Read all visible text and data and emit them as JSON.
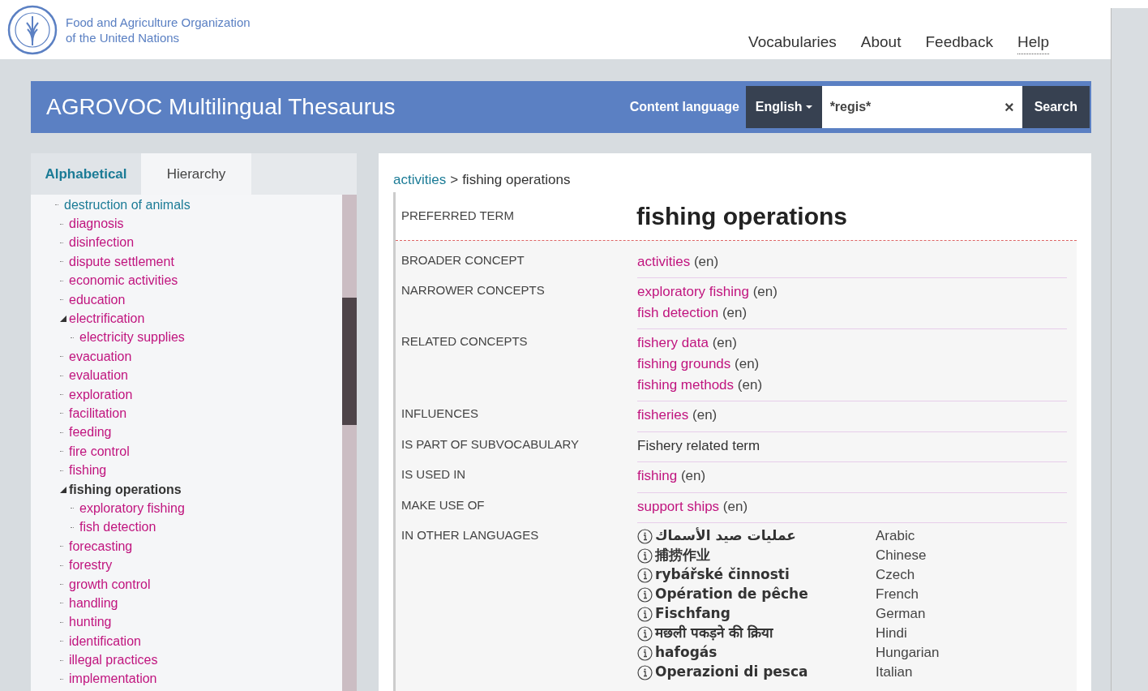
{
  "header": {
    "org_name": [
      "Food and Agriculture Organization",
      "of the United Nations"
    ],
    "nav": [
      {
        "label": "Vocabularies",
        "dotted": false
      },
      {
        "label": "About",
        "dotted": false
      },
      {
        "label": "Feedback",
        "dotted": false
      },
      {
        "label": "Help",
        "dotted": true
      }
    ]
  },
  "banner": {
    "title": "AGROVOC Multilingual Thesaurus",
    "content_language_label": "Content language",
    "language": "English",
    "search_value": "*regis*",
    "clear": "×",
    "search_button": "Search"
  },
  "sidebar": {
    "tabs": [
      {
        "label": "Alphabetical",
        "selected": true
      },
      {
        "label": "Hierarchy",
        "selected": false
      }
    ],
    "tree": [
      {
        "label": "destruction of animals",
        "visited": true,
        "selected": false
      },
      {
        "label": "diagnosis",
        "visited": false,
        "selected": false
      },
      {
        "label": "disinfection",
        "visited": false,
        "selected": false
      },
      {
        "label": "dispute settlement",
        "visited": false,
        "selected": false
      },
      {
        "label": "economic activities",
        "visited": false,
        "selected": false
      },
      {
        "label": "education",
        "visited": false,
        "selected": false
      },
      {
        "label": "electrification",
        "visited": false,
        "selected": false,
        "expanded": true,
        "children": [
          {
            "label": "electricity supplies",
            "visited": false,
            "selected": false
          }
        ]
      },
      {
        "label": "evacuation",
        "visited": false,
        "selected": false
      },
      {
        "label": "evaluation",
        "visited": false,
        "selected": false
      },
      {
        "label": "exploration",
        "visited": false,
        "selected": false
      },
      {
        "label": "facilitation",
        "visited": false,
        "selected": false
      },
      {
        "label": "feeding",
        "visited": false,
        "selected": false
      },
      {
        "label": "fire control",
        "visited": false,
        "selected": false
      },
      {
        "label": "fishing",
        "visited": false,
        "selected": false
      },
      {
        "label": "fishing operations",
        "visited": false,
        "selected": true,
        "expanded": true,
        "children": [
          {
            "label": "exploratory fishing",
            "visited": false,
            "selected": false
          },
          {
            "label": "fish detection",
            "visited": false,
            "selected": false
          }
        ]
      },
      {
        "label": "forecasting",
        "visited": false,
        "selected": false
      },
      {
        "label": "forestry",
        "visited": false,
        "selected": false
      },
      {
        "label": "growth control",
        "visited": false,
        "selected": false
      },
      {
        "label": "handling",
        "visited": false,
        "selected": false
      },
      {
        "label": "hunting",
        "visited": false,
        "selected": false
      },
      {
        "label": "identification",
        "visited": false,
        "selected": false
      },
      {
        "label": "illegal practices",
        "visited": false,
        "selected": false
      },
      {
        "label": "implementation",
        "visited": false,
        "selected": false
      }
    ]
  },
  "concept": {
    "breadcrumb": {
      "parent": "activities",
      "separator": ">",
      "current": "fishing operations"
    },
    "preferred_term_label": "PREFERRED TERM",
    "preferred_term": "fishing operations",
    "properties": [
      {
        "label": "BROADER CONCEPT",
        "values": [
          {
            "text": "activities",
            "lang": "(en)",
            "kind": "link"
          }
        ]
      },
      {
        "label": "NARROWER CONCEPTS",
        "values": [
          {
            "text": "exploratory fishing",
            "lang": "(en)",
            "kind": "link"
          },
          {
            "text": "fish detection",
            "lang": "(en)",
            "kind": "link"
          }
        ]
      },
      {
        "label": "RELATED CONCEPTS",
        "values": [
          {
            "text": "fishery data",
            "lang": "(en)",
            "kind": "link"
          },
          {
            "text": "fishing grounds",
            "lang": "(en)",
            "kind": "link"
          },
          {
            "text": "fishing methods",
            "lang": "(en)",
            "kind": "link"
          }
        ]
      },
      {
        "label": "INFLUENCES",
        "values": [
          {
            "text": "fisheries",
            "lang": "(en)",
            "kind": "link"
          }
        ]
      },
      {
        "label": "IS PART OF SUBVOCABULARY",
        "values": [
          {
            "text": "Fishery related term",
            "kind": "plain"
          }
        ]
      },
      {
        "label": "IS USED IN",
        "values": [
          {
            "text": "fishing",
            "lang": "(en)",
            "kind": "link"
          }
        ]
      },
      {
        "label": "MAKE USE OF",
        "values": [
          {
            "text": "support ships",
            "lang": "(en)",
            "kind": "link"
          }
        ]
      }
    ],
    "other_languages_label": "IN OTHER LANGUAGES",
    "other_languages": [
      {
        "term": "عمليات صيد الأسماك",
        "language": "Arabic"
      },
      {
        "term": "捕捞作业",
        "language": "Chinese"
      },
      {
        "term": "rybářské činnosti",
        "language": "Czech"
      },
      {
        "term": "Opération de pêche",
        "language": "French"
      },
      {
        "term": "Fischfang",
        "language": "German"
      },
      {
        "term": "मछली पकड़ने की क्रिया",
        "language": "Hindi"
      },
      {
        "term": "hafogás",
        "language": "Hungarian"
      },
      {
        "term": "Operazioni di pesca",
        "language": "Italian"
      }
    ]
  }
}
